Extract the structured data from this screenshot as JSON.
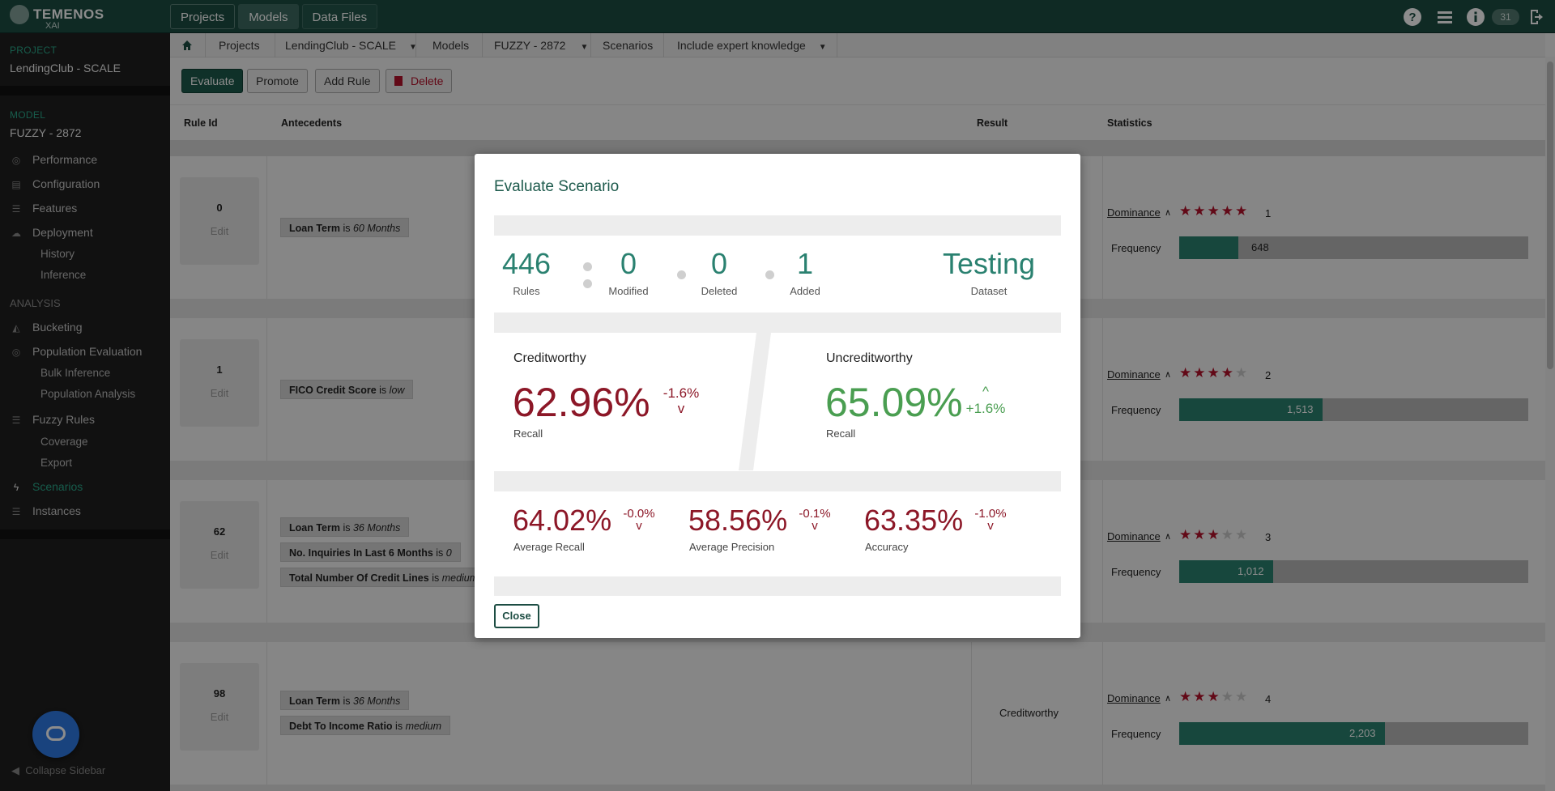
{
  "app": {
    "logo_name": "TEMENOS",
    "logo_sub": "XAI"
  },
  "topnav": [
    "Projects",
    "Models",
    "Data Files"
  ],
  "topbar": {
    "notification_count": "31"
  },
  "sidebar": {
    "project_label": "PROJECT",
    "project_name": "LendingClub - SCALE",
    "model_label": "MODEL",
    "model_name": "FUZZY - 2872",
    "model_items": [
      "Performance",
      "Configuration",
      "Features",
      "Deployment"
    ],
    "deployment_sub": [
      "History",
      "Inference"
    ],
    "analysis_label": "ANALYSIS",
    "analysis_items": [
      "Bucketing",
      "Population Evaluation"
    ],
    "population_sub": [
      "Bulk Inference",
      "Population Analysis"
    ],
    "fuzzy_rules": "Fuzzy Rules",
    "fuzzy_sub": [
      "Coverage",
      "Export"
    ],
    "scenarios": "Scenarios",
    "instances": "Instances",
    "collapse": "Collapse Sidebar"
  },
  "breadcrumb": [
    "Projects",
    "LendingClub - SCALE",
    "Models",
    "FUZZY - 2872",
    "Scenarios",
    "Include expert knowledge"
  ],
  "toolbar": {
    "evaluate": "Evaluate",
    "promote": "Promote",
    "add_rule": "Add Rule",
    "delete": "Delete"
  },
  "table": {
    "headers": [
      "Rule Id",
      "Antecedents",
      "Result",
      "Statistics"
    ],
    "dominance_label": "Dominance",
    "frequency_label": "Frequency",
    "edit_label": "Edit",
    "rows": [
      {
        "id": "0",
        "antecedents": [
          {
            "feature": "Loan Term",
            "op": "is",
            "value": "60 Months"
          }
        ],
        "result": "",
        "stars": 5,
        "rank": "1",
        "frequency": "648",
        "frequency_fraction": 0.17
      },
      {
        "id": "1",
        "antecedents": [
          {
            "feature": "FICO Credit Score",
            "op": "is",
            "value": "low"
          }
        ],
        "result": "",
        "stars": 4,
        "rank": "2",
        "frequency": "1,513",
        "frequency_fraction": 0.41
      },
      {
        "id": "62",
        "antecedents": [
          {
            "feature": "Loan Term",
            "op": "is",
            "value": "36 Months"
          },
          {
            "feature": "No. Inquiries In Last 6 Months",
            "op": "is",
            "value": "0"
          },
          {
            "feature": "Total Number Of Credit Lines",
            "op": "is",
            "value": "medium"
          }
        ],
        "result": "",
        "stars": 3,
        "rank": "3",
        "frequency": "1,012",
        "frequency_fraction": 0.27
      },
      {
        "id": "98",
        "antecedents": [
          {
            "feature": "Loan Term",
            "op": "is",
            "value": "36 Months"
          },
          {
            "feature": "Debt To Income Ratio",
            "op": "is",
            "value": "medium"
          }
        ],
        "result": "Creditworthy",
        "stars": 3,
        "rank": "4",
        "frequency": "2,203",
        "frequency_fraction": 0.59
      }
    ]
  },
  "modal": {
    "title": "Evaluate Scenario",
    "stats": [
      {
        "value": "446",
        "label": "Rules"
      },
      {
        "value": "0",
        "label": "Modified"
      },
      {
        "value": "0",
        "label": "Deleted"
      },
      {
        "value": "1",
        "label": "Added"
      }
    ],
    "dataset": {
      "value": "Testing",
      "label": "Dataset"
    },
    "creditworthy": {
      "title": "Creditworthy",
      "value": "62.96%",
      "delta": "-1.6%",
      "arrow": "v",
      "label": "Recall"
    },
    "uncreditworthy": {
      "title": "Uncreditworthy",
      "value": "65.09%",
      "delta": "+1.6%",
      "arrow": "^",
      "label": "Recall"
    },
    "metrics": [
      {
        "value": "64.02%",
        "delta": "-0.0%",
        "arrow": "v",
        "label": "Average Recall"
      },
      {
        "value": "58.56%",
        "delta": "-0.1%",
        "arrow": "v",
        "label": "Average Precision"
      },
      {
        "value": "63.35%",
        "delta": "-1.0%",
        "arrow": "v",
        "label": "Accuracy"
      }
    ],
    "close": "Close"
  },
  "colors": {
    "brand": "#1d4d43",
    "accent": "#2aa98b",
    "negative": "#8c1727",
    "positive": "#4a9e51",
    "star": "#b3122b",
    "freq_fill": "#2a8170"
  },
  "icons": [
    "home-icon",
    "help-icon",
    "menu-icon",
    "info-icon",
    "logout-icon",
    "chat-icon",
    "trash-icon"
  ]
}
